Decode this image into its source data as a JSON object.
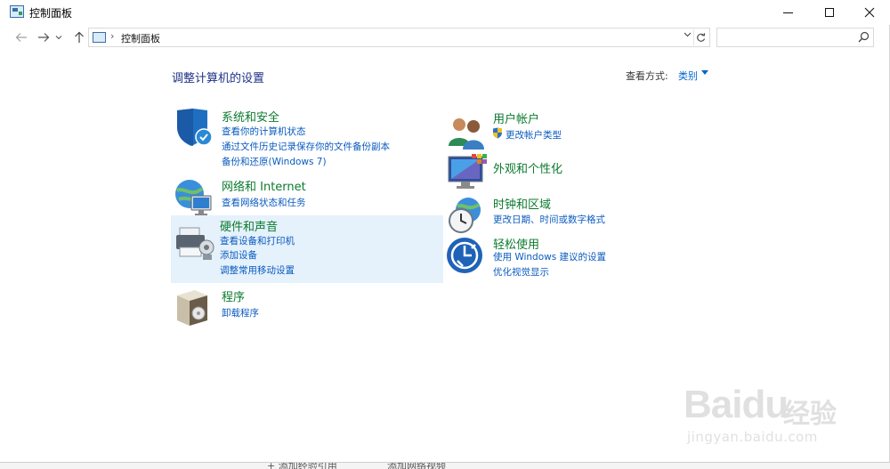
{
  "window": {
    "title": "控制面板"
  },
  "address": {
    "path": "控制面板",
    "separator": "›"
  },
  "search": {
    "placeholder": ""
  },
  "content": {
    "heading": "调整计算机的设置",
    "view_by_label": "查看方式:",
    "view_by_value": "类别"
  },
  "categories": {
    "system": {
      "title": "系统和安全",
      "links": [
        "查看你的计算机状态",
        "通过文件历史记录保存你的文件备份副本",
        "备份和还原(Windows 7)"
      ]
    },
    "network": {
      "title": "网络和 Internet",
      "links": [
        "查看网络状态和任务"
      ]
    },
    "hardware": {
      "title": "硬件和声音",
      "links": [
        "查看设备和打印机",
        "添加设备",
        "调整常用移动设置"
      ]
    },
    "programs": {
      "title": "程序",
      "links": [
        "卸载程序"
      ]
    },
    "user": {
      "title": "用户帐户",
      "links": [
        "更改帐户类型"
      ]
    },
    "appearance": {
      "title": "外观和个性化",
      "links": []
    },
    "clock": {
      "title": "时钟和区域",
      "links": [
        "更改日期、时间或数字格式"
      ]
    },
    "ease": {
      "title": "轻松使用",
      "links": [
        "使用 Windows 建议的设置",
        "优化视觉显示"
      ]
    }
  },
  "background": {
    "items": [
      "+ 添加经验引用",
      "添加网络视频"
    ]
  },
  "watermark": {
    "logo": "Baidu",
    "brand": "经验",
    "url": "jingyan.baidu.com"
  },
  "colors": {
    "category_title": "#0b7a2e",
    "link": "#0a5bbf",
    "heading": "#1e3287",
    "highlight": "#e5f1fb"
  }
}
